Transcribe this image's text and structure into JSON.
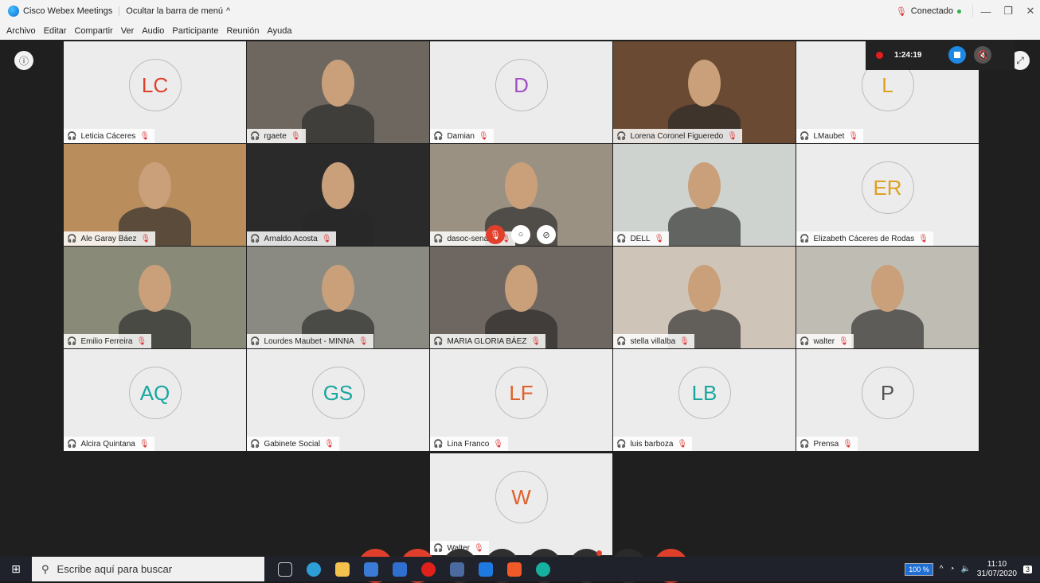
{
  "titlebar": {
    "app_title": "Cisco Webex Meetings",
    "hide_menu": "Ocultar la barra de menú",
    "hide_menu_chevron": "^",
    "status": "Conectado",
    "minimize": "—",
    "restore": "❐",
    "close": "✕"
  },
  "menu": [
    "Archivo",
    "Editar",
    "Compartir",
    "Ver",
    "Audio",
    "Participante",
    "Reunión",
    "Ayuda"
  ],
  "recording": {
    "time": "1:24:19"
  },
  "participants": [
    {
      "name": "Leticia Cáceres",
      "initials": "LC",
      "color": "#e0402b",
      "video": false
    },
    {
      "name": "rgaete",
      "initials": "",
      "video": true,
      "bg": "#6e6760"
    },
    {
      "name": "Damian",
      "initials": "D",
      "color": "#a24fc4",
      "video": false
    },
    {
      "name": "Lorena Coronel Figueredo",
      "initials": "",
      "video": true,
      "bg": "#6a4a33"
    },
    {
      "name": "LMaubet",
      "initials": "L",
      "color": "#e0a020",
      "video": false
    },
    {
      "name": "Ale Garay Báez",
      "initials": "",
      "video": true,
      "bg": "#b98d5c"
    },
    {
      "name": "Arnaldo Acosta",
      "initials": "",
      "video": true,
      "bg": "#2a2a2a"
    },
    {
      "name": "dasoc-senasa",
      "initials": "",
      "video": true,
      "bg": "#9a9183"
    },
    {
      "name": "DELL",
      "initials": "",
      "video": true,
      "bg": "#cfd3cf"
    },
    {
      "name": "Elizabeth Cáceres de Rodas",
      "initials": "ER",
      "color": "#e0a020",
      "video": false
    },
    {
      "name": "Emilio Ferreira",
      "initials": "",
      "video": true,
      "bg": "#8a8a78"
    },
    {
      "name": "Lourdes Maubet - MINNA",
      "initials": "",
      "video": true,
      "bg": "#8a8a82"
    },
    {
      "name": "MARIA GLORIA BÁEZ",
      "initials": "",
      "video": true,
      "bg": "#6e6660"
    },
    {
      "name": "stella villalba",
      "initials": "",
      "video": true,
      "bg": "#cfc4b8"
    },
    {
      "name": "walter",
      "initials": "",
      "video": true,
      "bg": "#bfbcb3"
    },
    {
      "name": "Alcira Quintana",
      "initials": "AQ",
      "color": "#1aa6a0",
      "video": false
    },
    {
      "name": "Gabinete Social",
      "initials": "GS",
      "color": "#1aa6a0",
      "video": false
    },
    {
      "name": "Lina Franco",
      "initials": "LF",
      "color": "#e0602b",
      "video": false
    },
    {
      "name": "luis barboza",
      "initials": "LB",
      "color": "#1aa6a0",
      "video": false
    },
    {
      "name": "Prensa",
      "initials": "P",
      "color": "#555555",
      "video": false
    }
  ],
  "last_participant": {
    "name": "Walter",
    "initials": "W",
    "color": "#e0602b"
  },
  "controls": {
    "mute": "🎙",
    "video": "▶",
    "share": "⇪",
    "record": "◉",
    "participants": "👤",
    "chat": "💬",
    "more": "···",
    "leave": "✕"
  },
  "taskbar": {
    "search_placeholder": "Escribe aquí para buscar",
    "battery": "100 %",
    "time": "11:10",
    "date": "31/07/2020",
    "notifications": "3"
  }
}
